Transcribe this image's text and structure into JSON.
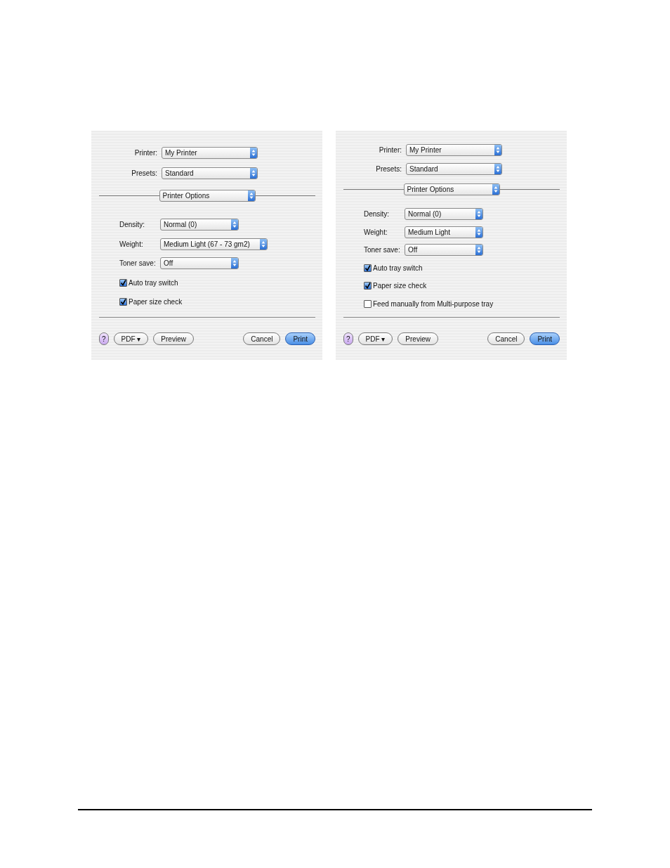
{
  "dialogs": [
    {
      "printer": {
        "label": "Printer:",
        "value": "My Printer"
      },
      "presets": {
        "label": "Presets:",
        "value": "Standard"
      },
      "pane": {
        "value": "Printer Options"
      },
      "options": [
        {
          "kind": "select",
          "label": "Density:",
          "value": "Normal (0)"
        },
        {
          "kind": "select",
          "label": "Weight:",
          "value": "Medium Light (67 - 73 gm2)"
        },
        {
          "kind": "select",
          "label": "Toner save:",
          "value": "Off"
        },
        {
          "kind": "checkbox",
          "label": "Auto tray switch",
          "checked": true
        },
        {
          "kind": "checkbox",
          "label": "Paper size check",
          "checked": true
        }
      ],
      "buttons": [
        {
          "kind": "help",
          "label": "?"
        },
        {
          "kind": "menu",
          "label": "PDF ▾"
        },
        {
          "kind": "plain",
          "label": "Preview"
        },
        {
          "kind": "spacer"
        },
        {
          "kind": "plain",
          "label": "Cancel"
        },
        {
          "kind": "default",
          "label": "Print"
        }
      ]
    },
    {
      "printer": {
        "label": "Printer:",
        "value": "My Printer"
      },
      "presets": {
        "label": "Presets:",
        "value": "Standard"
      },
      "pane": {
        "value": "Printer Options"
      },
      "options": [
        {
          "kind": "select",
          "label": "Density:",
          "value": "Normal (0)"
        },
        {
          "kind": "select",
          "label": "Weight:",
          "value": "Medium Light"
        },
        {
          "kind": "select",
          "label": "Toner save:",
          "value": "Off"
        },
        {
          "kind": "checkbox",
          "label": "Auto tray switch",
          "checked": true
        },
        {
          "kind": "checkbox",
          "label": "Paper size check",
          "checked": true
        },
        {
          "kind": "checkbox",
          "label": "Feed manually from Multi-purpose tray",
          "checked": false
        }
      ],
      "buttons": [
        {
          "kind": "help",
          "label": "?"
        },
        {
          "kind": "menu",
          "label": "PDF ▾"
        },
        {
          "kind": "plain",
          "label": "Preview"
        },
        {
          "kind": "spacer"
        },
        {
          "kind": "plain",
          "label": "Cancel"
        },
        {
          "kind": "default",
          "label": "Print"
        }
      ]
    }
  ]
}
